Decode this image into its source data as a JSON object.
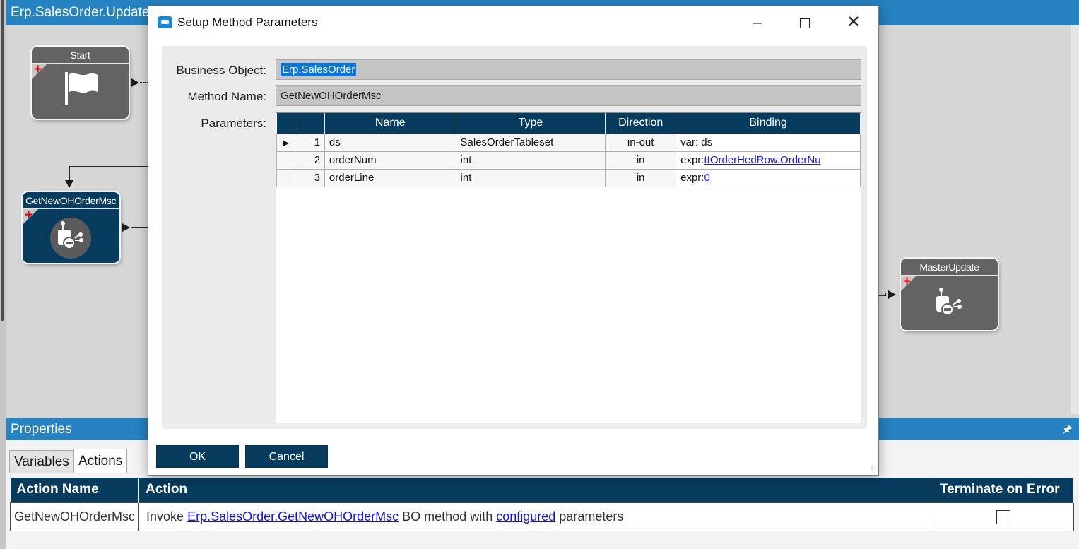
{
  "designer": {
    "title": "Erp.SalesOrder.Update",
    "nodes": {
      "start": "Start",
      "method": "GetNewOHOrderMsc",
      "master": "MasterUpdate"
    }
  },
  "dialog": {
    "title": "Setup Method Parameters",
    "business_object_label": "Business Object:",
    "business_object_value": "Erp.SalesOrder",
    "method_name_label": "Method Name:",
    "method_name_value": "GetNewOHOrderMsc",
    "parameters_label": "Parameters:",
    "columns": [
      "Name",
      "Type",
      "Direction",
      "Binding"
    ],
    "rows": [
      {
        "index": "1",
        "name": "ds",
        "type": "SalesOrderTableset",
        "direction": "in-out",
        "binding_prefix": "var: ds",
        "binding_link": ""
      },
      {
        "index": "2",
        "name": "orderNum",
        "type": "int",
        "direction": "in",
        "binding_prefix": "expr:",
        "binding_link": "ttOrderHedRow.OrderNu"
      },
      {
        "index": "3",
        "name": "orderLine",
        "type": "int",
        "direction": "in",
        "binding_prefix": "expr:",
        "binding_link": "0"
      }
    ],
    "ok_label": "OK",
    "cancel_label": "Cancel"
  },
  "properties": {
    "title": "Properties",
    "tabs": [
      "Variables",
      "Actions"
    ],
    "active_tab": "Actions",
    "columns": [
      "Action Name",
      "Action",
      "Terminate on Error"
    ],
    "row": {
      "action_name": "GetNewOHOrderMsc",
      "text_invoke": "Invoke ",
      "link_method": "Erp.SalesOrder.GetNewOHOrderMsc",
      "text_mid": " BO method with ",
      "link_configured": "configured",
      "text_end": " parameters",
      "terminate_on_error": false
    }
  },
  "colors": {
    "titlebar_blue": "#2682c0",
    "navy": "#083c5f",
    "node_grey": "#636363",
    "link_blue": "#1818e8"
  },
  "icons": [
    "flag-icon",
    "workflow-method-icon",
    "plus-icon",
    "pin-icon",
    "close-icon",
    "maximize-icon",
    "minimize-icon",
    "row-pointer-icon"
  ]
}
